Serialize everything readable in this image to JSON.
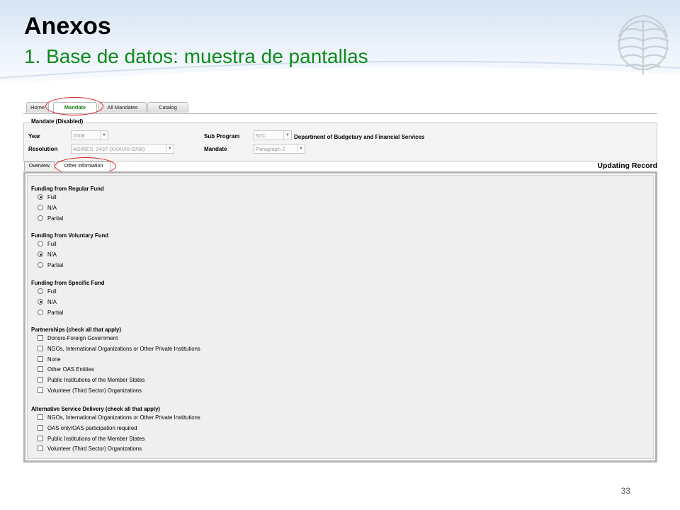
{
  "slide": {
    "title": "Anexos",
    "subtitle": "1. Base de datos: muestra de pantallas",
    "page_number": "33"
  },
  "app": {
    "tabs": [
      "Home",
      "Mandate",
      "All Mandates",
      "Catalog"
    ],
    "active_tab": "Mandate",
    "section_legend": "Mandate (Disabled)",
    "fields": {
      "year_label": "Year",
      "year_value": "2008",
      "resolution_label": "Resolution",
      "resolution_value": "AG/RES. 2437 (XXXVIII-O/08)",
      "subprogram_label": "Sub Program",
      "subprogram_value": "92C",
      "department": "Department of Budgetary and Financial Services",
      "mandate_label": "Mandate",
      "mandate_value": "Paragraph 2"
    },
    "subtabs": [
      "Overview",
      "Other Information"
    ],
    "active_subtab": "Other Information",
    "status": "Updating Record",
    "groups": [
      {
        "title": "Funding from Regular Fund",
        "type": "radio",
        "options": [
          {
            "label": "Full",
            "checked": true
          },
          {
            "label": "N/A",
            "checked": false
          },
          {
            "label": "Partial",
            "checked": false
          }
        ]
      },
      {
        "title": "Funding from Voluntary Fund",
        "type": "radio",
        "options": [
          {
            "label": "Full",
            "checked": false
          },
          {
            "label": "N/A",
            "checked": true
          },
          {
            "label": "Partial",
            "checked": false
          }
        ]
      },
      {
        "title": "Funding from Specific Fund",
        "type": "radio",
        "options": [
          {
            "label": "Full",
            "checked": false
          },
          {
            "label": "N/A",
            "checked": true
          },
          {
            "label": "Partial",
            "checked": false
          }
        ]
      },
      {
        "title": "Partnerships (check all that apply)",
        "type": "checkbox",
        "options": [
          {
            "label": "Donors-Foreign Government",
            "checked": false
          },
          {
            "label": "NGOs, International Organizations or Other Private Institutions",
            "checked": false
          },
          {
            "label": "None",
            "checked": false
          },
          {
            "label": "Other OAS Entities",
            "checked": false
          },
          {
            "label": "Public Institutions of the Member States",
            "checked": false
          },
          {
            "label": "Volunteer (Third Sector) Organizations",
            "checked": false
          }
        ]
      },
      {
        "title": "Alternative Service Delivery (check all that apply)",
        "type": "checkbox",
        "options": [
          {
            "label": "NGOs, International Organizations or Other Private Institutions",
            "checked": false
          },
          {
            "label": "OAS only/OAS participation required",
            "checked": false
          },
          {
            "label": "Public Institutions of the Member States",
            "checked": false
          },
          {
            "label": "Volunteer (Third Sector) Organizations",
            "checked": false
          }
        ]
      }
    ]
  }
}
